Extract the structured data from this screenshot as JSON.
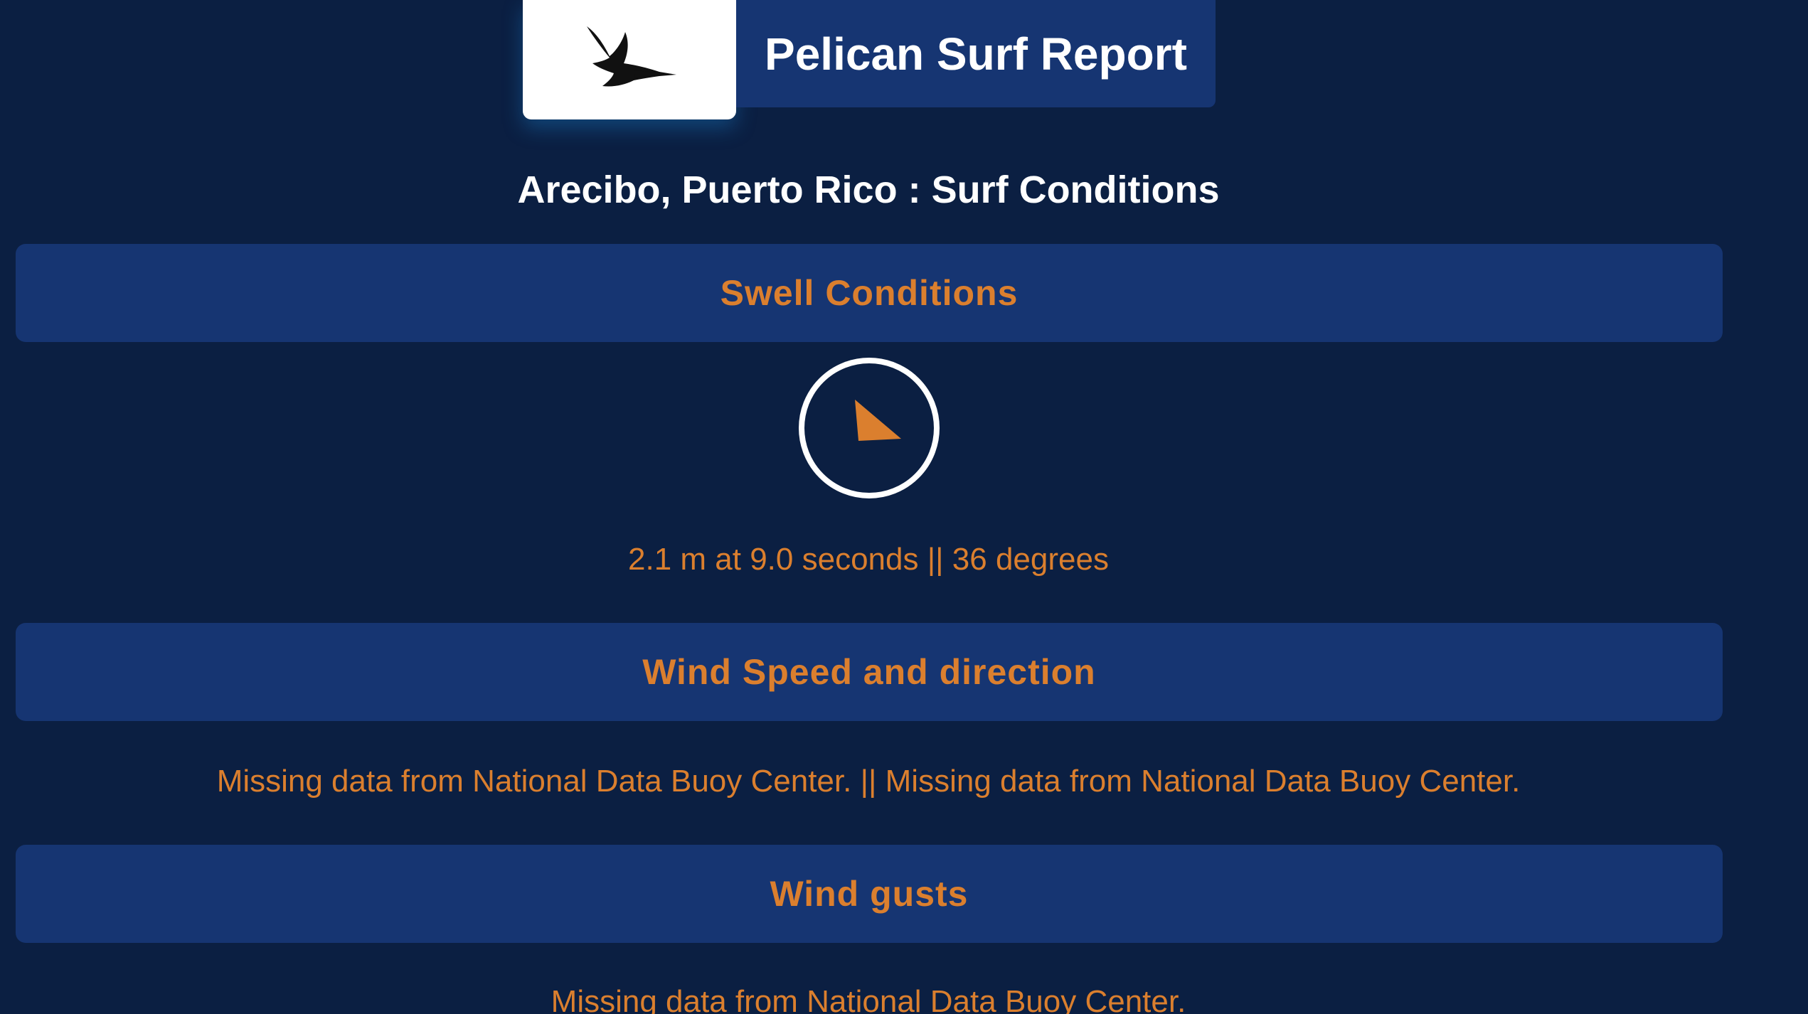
{
  "header": {
    "logo_icon": "pelican-icon",
    "title": "Pelican Surf Report"
  },
  "location_title": "Arecibo, Puerto Rico : Surf Conditions",
  "sections": {
    "swell": {
      "title": "Swell Conditions",
      "direction_icon": "direction-arrow-icon",
      "direction_degrees": 36,
      "value": "2.1 m at 9.0 seconds || 36 degrees"
    },
    "wind": {
      "title": "Wind Speed and direction",
      "value": "Missing data from National Data Buoy Center. || Missing data from National Data Buoy Center."
    },
    "gusts": {
      "title": "Wind gusts",
      "value": "Missing data from National Data Buoy Center."
    }
  },
  "colors": {
    "background": "#0b1f42",
    "panel": "#163572",
    "accent": "#db7f2e",
    "text": "#ffffff"
  }
}
